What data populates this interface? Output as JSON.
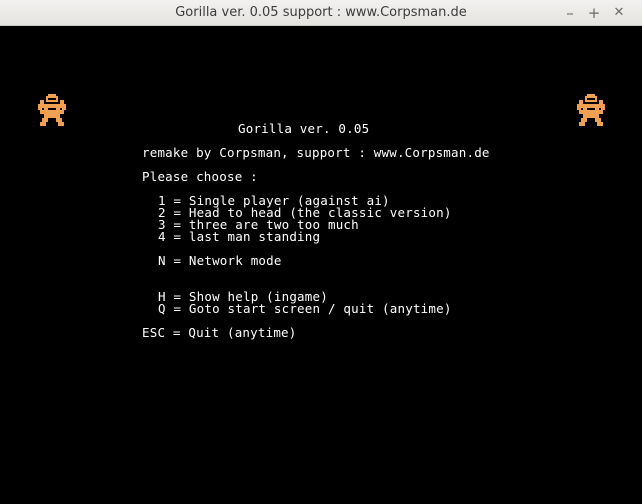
{
  "window": {
    "title": "Gorilla ver. 0.05 support : www.Corpsman.de",
    "minimize_label": "–",
    "maximize_label": "+",
    "close_label": "✕"
  },
  "menu": {
    "title": "Gorilla ver. 0.05",
    "credit": "remake by Corpsman, support : www.Corpsman.de",
    "prompt": "Please choose :",
    "options": [
      "1 = Single player (against ai)",
      "2 = Head to head (the classic version)",
      "3 = three are two too much",
      "4 = last man standing"
    ],
    "network": "N = Network mode",
    "help": "H = Show help (ingame)",
    "goto": "Q = Goto start screen / quit (anytime)",
    "esc": "ESC = Quit (anytime)"
  },
  "colors": {
    "gorilla": "#f0a050",
    "background": "#000000",
    "text": "#ffffff"
  },
  "icons": {
    "left_sprite": "gorilla-sprite",
    "right_sprite": "gorilla-sprite"
  }
}
